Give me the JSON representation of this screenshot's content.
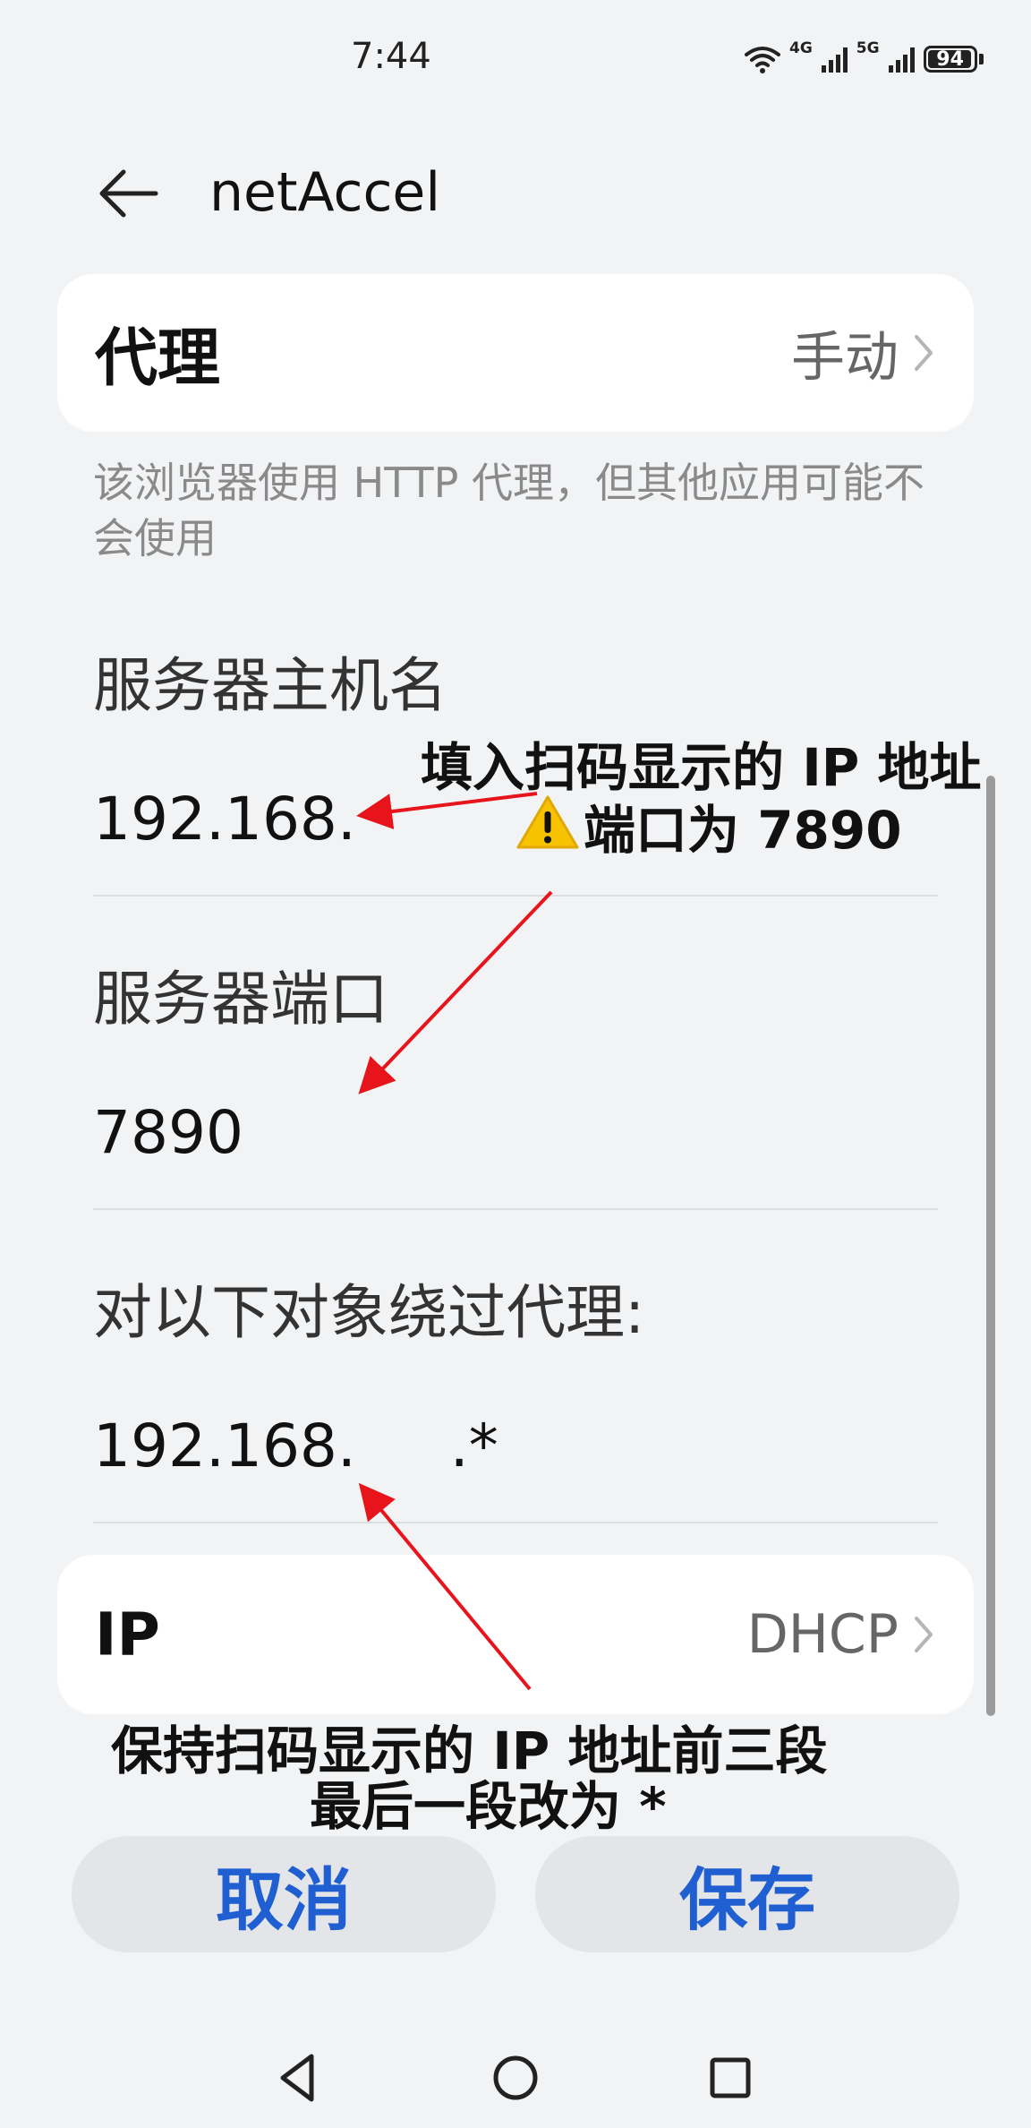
{
  "status_bar": {
    "time": "7:44",
    "network_1": "4G",
    "network_2": "5G",
    "battery": "94"
  },
  "header": {
    "title": "netAccel",
    "back_icon": "arrow-left-icon"
  },
  "proxy": {
    "label": "代理",
    "value": "手动",
    "hint": "该浏览器使用 HTTP 代理，但其他应用可能不会使用"
  },
  "form": {
    "host_label": "服务器主机名",
    "host_value": "192.168.",
    "port_label": "服务器端口",
    "port_value": "7890",
    "bypass_label": "对以下对象绕过代理:",
    "bypass_value": "192.168.     .*"
  },
  "ip_settings": {
    "label": "IP",
    "value": "DHCP"
  },
  "annotations": {
    "top_line1": "填入扫码显示的 IP 地址",
    "top_line2": "端口为 7890",
    "bottom_line1": "保持扫码显示的 IP 地址前三段",
    "bottom_line2": "最后一段改为 *",
    "arrow_color": "#e8141c",
    "warning_icon": "warning-icon"
  },
  "buttons": {
    "cancel": "取消",
    "save": "保存"
  },
  "colors": {
    "accent": "#1f5fd1",
    "background": "#f1f3f5",
    "card": "#ffffff"
  },
  "nav_bar": {
    "back": "triangle-back-icon",
    "home": "circle-home-icon",
    "recents": "square-recents-icon"
  }
}
